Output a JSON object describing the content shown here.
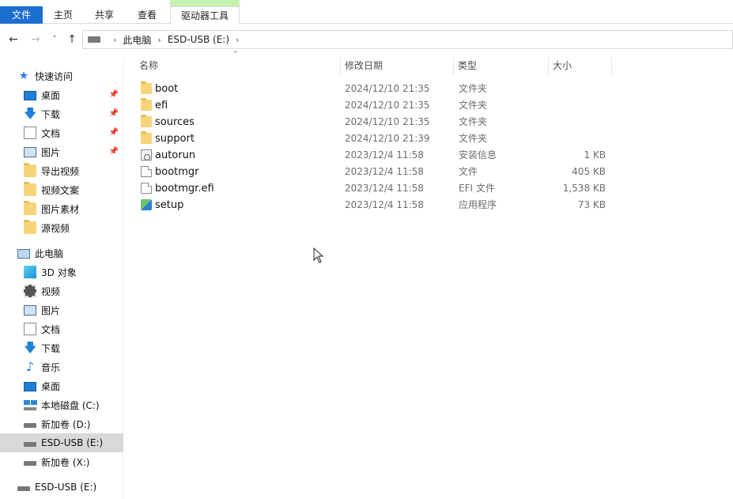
{
  "ribbon": {
    "tabs": [
      "文件",
      "主页",
      "共享",
      "查看",
      "驱动器工具"
    ]
  },
  "address": {
    "crumbs": [
      "此电脑",
      "ESD-USB (E:)"
    ]
  },
  "sidebar": {
    "quick_access": "快速访问",
    "quick_items": [
      "桌面",
      "下载",
      "文档",
      "图片",
      "导出视频",
      "视频文案",
      "图片素材",
      "源视频"
    ],
    "this_pc": "此电脑",
    "pc_items": [
      "3D 对象",
      "视频",
      "图片",
      "文档",
      "下载",
      "音乐",
      "桌面",
      "本地磁盘 (C:)",
      "新加卷 (D:)",
      "ESD-USB (E:)",
      "新加卷 (X:)"
    ],
    "bottom_drive": "ESD-USB (E:)"
  },
  "columns": {
    "name": "名称",
    "date": "修改日期",
    "type": "类型",
    "size": "大小"
  },
  "files": [
    {
      "name": "boot",
      "date": "2024/12/10 21:35",
      "type": "文件夹",
      "size": "",
      "icon": "folder-icon"
    },
    {
      "name": "efi",
      "date": "2024/12/10 21:35",
      "type": "文件夹",
      "size": "",
      "icon": "folder-icon"
    },
    {
      "name": "sources",
      "date": "2024/12/10 21:35",
      "type": "文件夹",
      "size": "",
      "icon": "folder-icon"
    },
    {
      "name": "support",
      "date": "2024/12/10 21:39",
      "type": "文件夹",
      "size": "",
      "icon": "folder-icon"
    },
    {
      "name": "autorun",
      "date": "2023/12/4 11:58",
      "type": "安装信息",
      "size": "1 KB",
      "icon": "ini-file-icon"
    },
    {
      "name": "bootmgr",
      "date": "2023/12/4 11:58",
      "type": "文件",
      "size": "405 KB",
      "icon": "file-icon"
    },
    {
      "name": "bootmgr.efi",
      "date": "2023/12/4 11:58",
      "type": "EFI 文件",
      "size": "1,538 KB",
      "icon": "file-icon"
    },
    {
      "name": "setup",
      "date": "2023/12/4 11:58",
      "type": "应用程序",
      "size": "73 KB",
      "icon": "setup-icon"
    }
  ],
  "colors": {
    "file_tab": "#1c6fcf",
    "drive_tools_accent": "#c4f0b0",
    "selected_nav": "#d9d9d9",
    "folder": "#f6d47a"
  }
}
